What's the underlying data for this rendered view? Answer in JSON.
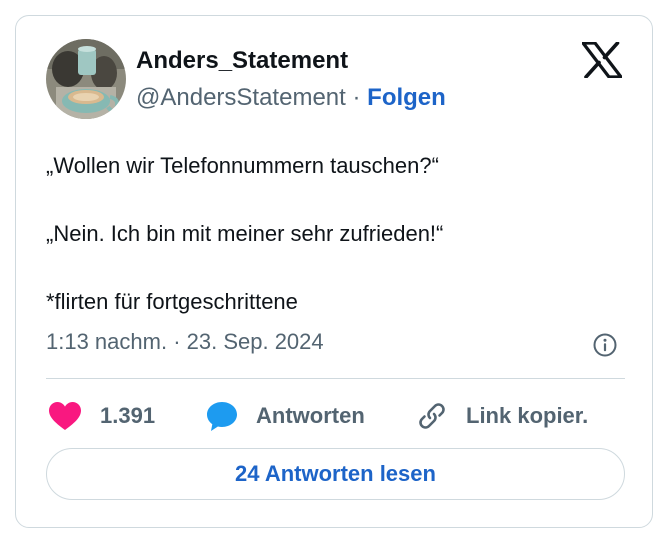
{
  "author": {
    "name": "Anders_Statement",
    "handle": "@AndersStatement",
    "separator": "·",
    "follow_label": "Folgen"
  },
  "tweet": {
    "paragraphs": [
      "„Wollen wir Telefonnummern tauschen?“",
      "„Nein. Ich bin mit meiner sehr zufrieden!“",
      "*flirten für fortgeschrittene"
    ],
    "timestamp": "1:13 nachm. · 23. Sep. 2024"
  },
  "actions": {
    "like_count": "1.391",
    "reply_label": "Antworten",
    "copy_link_label": "Link kopier."
  },
  "read_replies_label": "24 Antworten lesen",
  "icons": {
    "brand": "x-logo-icon",
    "info": "info-icon",
    "like": "heart-icon",
    "reply": "speech-bubble-icon",
    "link": "link-icon"
  },
  "colors": {
    "link_blue": "#1d64c8",
    "heart": "#f91880",
    "reply_bubble": "#1d9bf0",
    "muted_text": "#536471",
    "border": "#cfd9de"
  }
}
